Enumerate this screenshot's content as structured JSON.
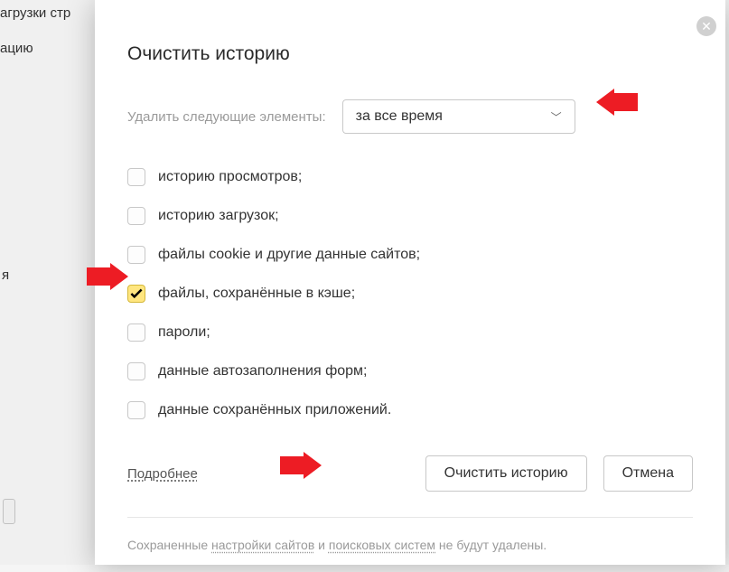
{
  "background": {
    "text1": "агрузки стр",
    "text2": "ацию",
    "text3": "я"
  },
  "dialog": {
    "title": "Очистить историю",
    "select_label": "Удалить следующие элементы:",
    "select_value": "за все время",
    "checks": [
      {
        "label": "историю просмотров;",
        "checked": false
      },
      {
        "label": "историю загрузок;",
        "checked": false
      },
      {
        "label": "файлы cookie и другие данные сайтов;",
        "checked": false
      },
      {
        "label": "файлы, сохранённые в кэше;",
        "checked": true
      },
      {
        "label": "пароли;",
        "checked": false
      },
      {
        "label": "данные автозаполнения форм;",
        "checked": false
      },
      {
        "label": "данные сохранённых приложений.",
        "checked": false
      }
    ],
    "more_link": "Подробнее",
    "primary_btn": "Очистить историю",
    "cancel_btn": "Отмена",
    "footer_pre": "Сохраненные ",
    "footer_l1": "настройки сайтов",
    "footer_mid": " и ",
    "footer_l2": "поисковых систем",
    "footer_post": " не будут удалены."
  }
}
